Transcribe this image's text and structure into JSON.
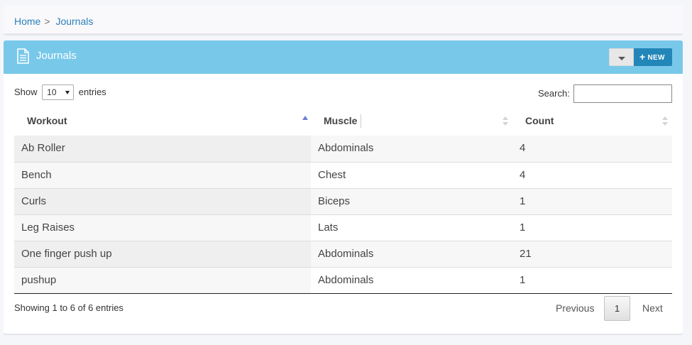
{
  "breadcrumb": {
    "home": "Home",
    "separator": ">",
    "current": "Journals"
  },
  "panel": {
    "title": "Journals",
    "icon": "document-icon",
    "new_button": "NEW",
    "new_button_icon": "plus-icon"
  },
  "length": {
    "prefix": "Show",
    "value": "10",
    "suffix": "entries"
  },
  "search": {
    "label": "Search:",
    "value": ""
  },
  "table": {
    "columns": [
      "Workout",
      "Muscle",
      "Count"
    ],
    "sorted_column": "Workout",
    "sort_direction": "asc",
    "rows": [
      [
        "Ab Roller",
        "Abdominals",
        "4"
      ],
      [
        "Bench",
        "Chest",
        "4"
      ],
      [
        "Curls",
        "Biceps",
        "1"
      ],
      [
        "Leg Raises",
        "Lats",
        "1"
      ],
      [
        "One finger push up",
        "Abdominals",
        "21"
      ],
      [
        "pushup",
        "Abdominals",
        "1"
      ]
    ]
  },
  "footer": {
    "info": "Showing 1 to 6 of 6 entries",
    "previous": "Previous",
    "page": "1",
    "next": "Next"
  },
  "colors": {
    "header": "#78c8ea",
    "accent": "#2386b8",
    "link": "#2a80b9"
  }
}
